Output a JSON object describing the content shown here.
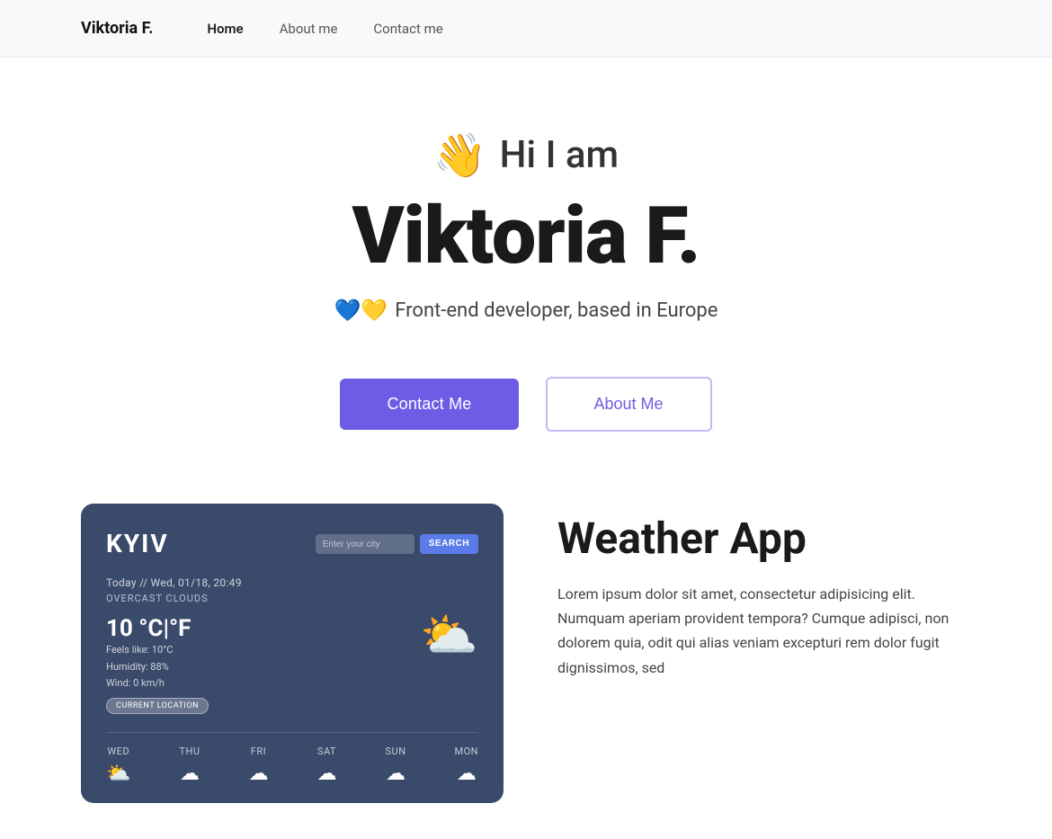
{
  "nav": {
    "brand": "Viktoria F.",
    "links": [
      {
        "label": "Home",
        "active": true
      },
      {
        "label": "About me",
        "active": false
      },
      {
        "label": "Contact me",
        "active": false
      }
    ]
  },
  "hero": {
    "wave_emoji": "👋",
    "greeting": "Hi I am",
    "name": "Viktoria F.",
    "hearts": "💙💛",
    "tagline": "Front-end developer, based in Europe",
    "btn_contact": "Contact Me",
    "btn_about": "About Me"
  },
  "weather_app": {
    "city": "Kyiv",
    "date": "Today // Wed, 01/18, 20:49",
    "description": "Overcast Clouds",
    "temp": "10 °C|°F",
    "feels_like": "Feels like: 10°C",
    "humidity": "Humidity: 88%",
    "wind": "Wind: 0 km/h",
    "current_location": "Current location",
    "search_placeholder": "Enter your city",
    "search_btn": "Search",
    "forecast": [
      {
        "day": "Wed",
        "icon": "⛅"
      },
      {
        "day": "Thu",
        "icon": "☁"
      },
      {
        "day": "Fri",
        "icon": "☁"
      },
      {
        "day": "Sat",
        "icon": "☁"
      },
      {
        "day": "Sun",
        "icon": "☁"
      },
      {
        "day": "Mon",
        "icon": "☁"
      }
    ]
  },
  "project": {
    "title": "Weather App",
    "description": "Lorem ipsum dolor sit amet, consectetur adipisicing elit. Numquam aperiam provident tempora? Cumque adipisci, non dolorem quia, odit qui alias veniam excepturi rem dolor fugit dignissimos, sed"
  }
}
